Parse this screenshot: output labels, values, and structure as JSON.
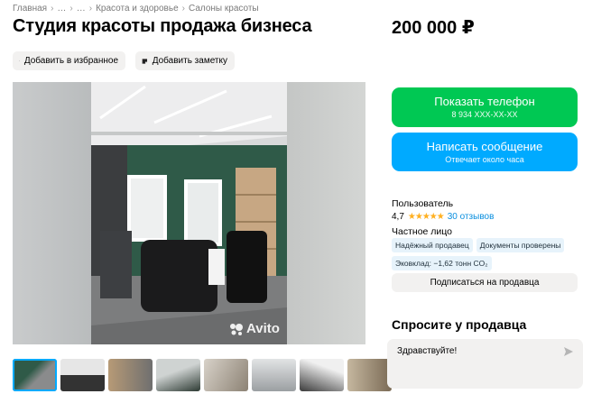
{
  "breadcrumb": [
    "Главная",
    "…",
    "…",
    "Красота и здоровье",
    "Салоны красоты"
  ],
  "listing": {
    "title": "Студия красоты продажа бизнеса",
    "price": "200 000 ₽"
  },
  "actions": {
    "favorite_label": "Добавить в избранное",
    "note_label": "Добавить заметку"
  },
  "gallery": {
    "watermark": "Avito",
    "thumbnail_count": 8,
    "active_index": 0
  },
  "contact": {
    "phone_label": "Показать телефон",
    "phone_masked": "8 934 XXX-XX-XX",
    "message_label": "Написать сообщение",
    "message_sub": "Отвечает около часа"
  },
  "seller": {
    "name": "Пользователь",
    "rating": "4,7",
    "stars": "★★★★★",
    "reviews": "30 отзывов",
    "type": "Частное лицо",
    "badges": [
      "Надёжный продавец",
      "Документы проверены",
      "Эковклад: −1,62 тонн CO₂"
    ],
    "subscribe_label": "Подписаться на продавца"
  },
  "ask": {
    "title": "Спросите у продавца",
    "message_value": "Здравствуйте!"
  },
  "colors": {
    "phone_button": "#00c853",
    "message_button": "#00aaff",
    "link": "#0a8fdf",
    "star": "#ffb021"
  }
}
